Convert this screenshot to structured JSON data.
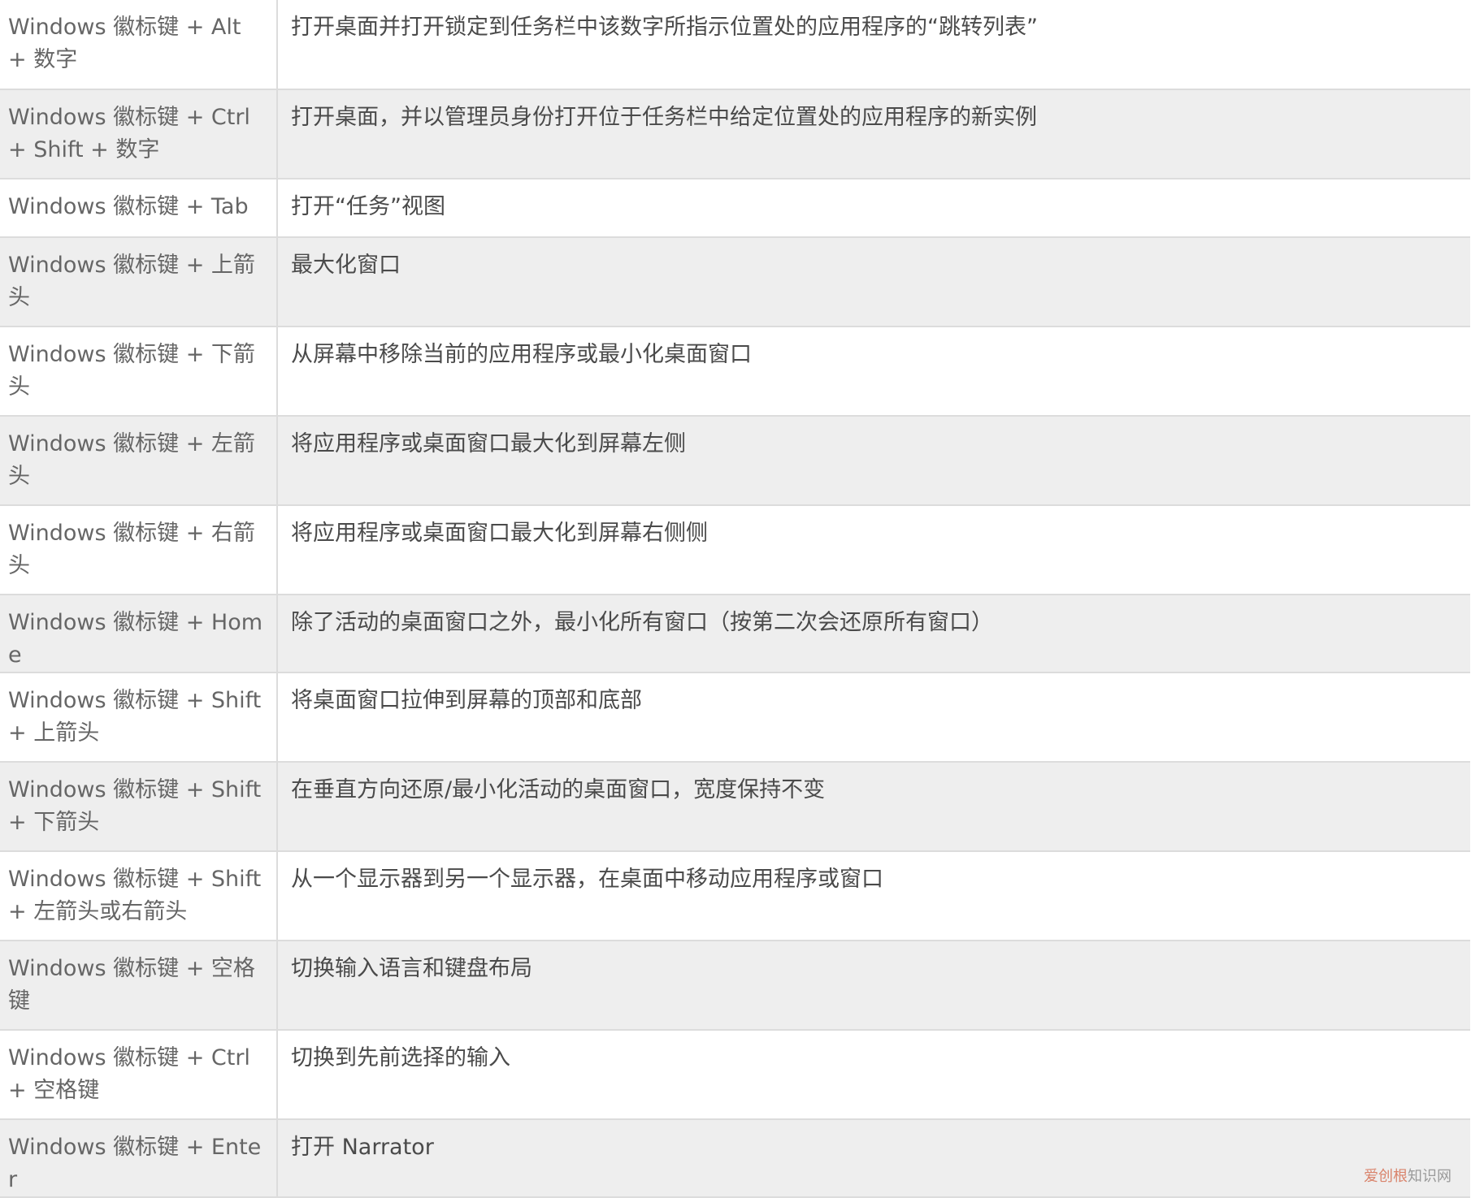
{
  "table": {
    "rows": [
      {
        "key": "Windows 徽标键 + Alt + 数字",
        "desc": "打开桌面并打开锁定到任务栏中该数字所指示位置处的应用程序的“跳转列表”"
      },
      {
        "key": "Windows 徽标键 + Ctrl + Shift + 数字",
        "desc": "打开桌面，并以管理员身份打开位于任务栏中给定位置处的应用程序的新实例"
      },
      {
        "key": "Windows 徽标键 + Tab",
        "desc": "打开“任务”视图"
      },
      {
        "key": "Windows 徽标键 + 上箭头",
        "desc": "最大化窗口"
      },
      {
        "key": "Windows 徽标键 + 下箭头",
        "desc": "从屏幕中移除当前的应用程序或最小化桌面窗口"
      },
      {
        "key": "Windows 徽标键 + 左箭头",
        "desc": "将应用程序或桌面窗口最大化到屏幕左侧"
      },
      {
        "key": "Windows 徽标键 + 右箭头",
        "desc": "将应用程序或桌面窗口最大化到屏幕右侧侧"
      },
      {
        "key": "Windows 徽标键 + Home",
        "desc": "除了活动的桌面窗口之外，最小化所有窗口（按第二次会还原所有窗口）"
      },
      {
        "key": "Windows 徽标键 + Shift + 上箭头",
        "desc": "将桌面窗口拉伸到屏幕的顶部和底部"
      },
      {
        "key": "Windows 徽标键 + Shift + 下箭头",
        "desc": "在垂直方向还原/最小化活动的桌面窗口，宽度保持不变"
      },
      {
        "key": "Windows 徽标键 + Shift + 左箭头或右箭头",
        "desc": "从一个显示器到另一个显示器，在桌面中移动应用程序或窗口"
      },
      {
        "key": "Windows 徽标键 + 空格键",
        "desc": "切换输入语言和键盘布局"
      },
      {
        "key": "Windows 徽标键 + Ctrl + 空格键",
        "desc": "切换到先前选择的输入"
      },
      {
        "key": "Windows 徽标键 + Enter",
        "desc": "打开 Narrator"
      }
    ]
  },
  "watermark": {
    "brand": "爱创根",
    "suffix": "知识网"
  }
}
